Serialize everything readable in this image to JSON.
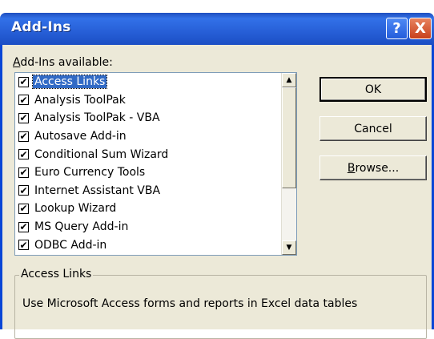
{
  "window": {
    "title": "Add-Ins",
    "help_label": "?",
    "close_label": "X"
  },
  "list": {
    "label_access_key": "A",
    "label_rest": "dd-Ins available:",
    "items": [
      {
        "label": "Access Links",
        "checked": true,
        "selected": true
      },
      {
        "label": "Analysis ToolPak",
        "checked": true
      },
      {
        "label": "Analysis ToolPak - VBA",
        "checked": true
      },
      {
        "label": "Autosave Add-in",
        "checked": true
      },
      {
        "label": "Conditional Sum Wizard",
        "checked": true
      },
      {
        "label": "Euro Currency Tools",
        "checked": true
      },
      {
        "label": "Internet Assistant VBA",
        "checked": true
      },
      {
        "label": "Lookup Wizard",
        "checked": true
      },
      {
        "label": "MS Query Add-in",
        "checked": true
      },
      {
        "label": "ODBC Add-in",
        "checked": true
      }
    ],
    "check_glyph": "✔"
  },
  "buttons": {
    "ok": "OK",
    "cancel": "Cancel",
    "browse_access_key": "B",
    "browse_rest": "rowse..."
  },
  "description": {
    "title": "Access Links",
    "text": "Use Microsoft Access forms and reports in Excel data tables"
  }
}
